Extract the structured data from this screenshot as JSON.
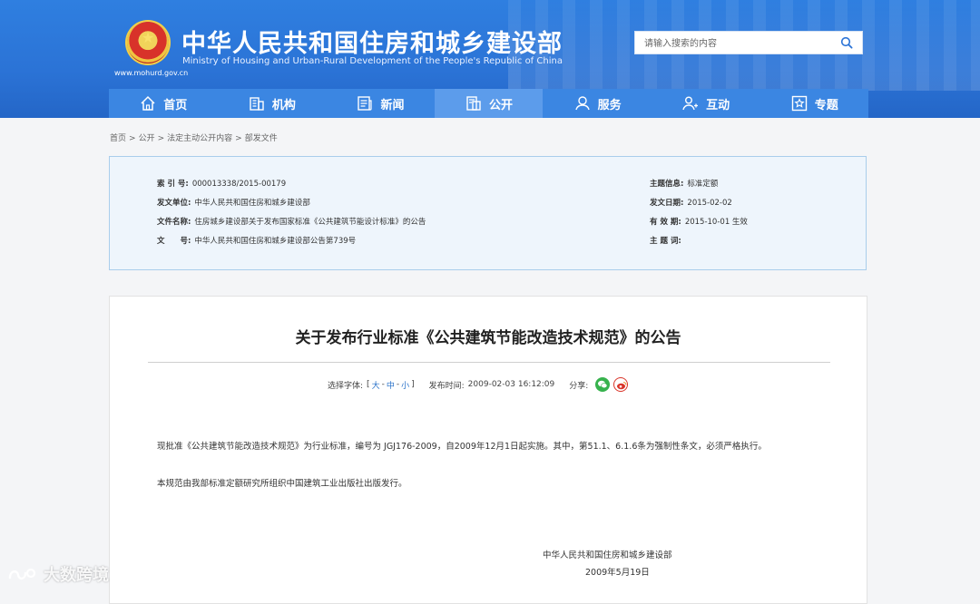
{
  "header": {
    "title": "中华人民共和国住房和城乡建设部",
    "subtitle": "Ministry of Housing and Urban-Rural Development of the People's Republic of China",
    "url": "www.mohurd.gov.cn",
    "emblem_icon": "national-emblem-icon",
    "search": {
      "placeholder": "请输入搜索的内容",
      "icon": "search-icon"
    }
  },
  "nav": {
    "items": [
      {
        "label": "首页",
        "icon": "home-icon",
        "active": false
      },
      {
        "label": "机构",
        "icon": "building-icon",
        "active": false
      },
      {
        "label": "新闻",
        "icon": "newspaper-icon",
        "active": false
      },
      {
        "label": "公开",
        "icon": "document-icon",
        "active": true
      },
      {
        "label": "服务",
        "icon": "service-icon",
        "active": false
      },
      {
        "label": "互动",
        "icon": "people-icon",
        "active": false
      },
      {
        "label": "专题",
        "icon": "star-icon",
        "active": false
      }
    ]
  },
  "breadcrumb": {
    "items": [
      "首页",
      "公开",
      "法定主动公开内容",
      "部发文件"
    ],
    "separator": ">"
  },
  "info": {
    "index_no": {
      "label": "索 引 号:",
      "value": "000013338/2015-00179"
    },
    "issuer": {
      "label": "发文单位:",
      "value": "中华人民共和国住房和城乡建设部"
    },
    "file_name": {
      "label": "文件名称:",
      "value": "住房城乡建设部关于发布国家标准《公共建筑节能设计标准》的公告"
    },
    "doc_no": {
      "label": "文　　号:",
      "value": "中华人民共和国住房和城乡建设部公告第739号"
    },
    "topic": {
      "label": "主题信息:",
      "value": "标准定额"
    },
    "date": {
      "label": "发文日期:",
      "value": "2015-02-02"
    },
    "validity": {
      "label": "有 效 期:",
      "value": "2015-10-01 生效"
    },
    "subject_words": {
      "label": "主 题 词:",
      "value": ""
    }
  },
  "article": {
    "title": "关于发布行业标准《公共建筑节能改造技术规范》的公告",
    "meta": {
      "font_label": "选择字体:",
      "font_open": "[",
      "font_large": "大",
      "font_medium": "中",
      "font_small": "小",
      "font_dash": "-",
      "font_close": "]",
      "publish_label": "发布时间:",
      "publish_time": "2009-02-03 16:12:09",
      "share_label": "分享:"
    },
    "paragraphs": [
      "现批准《公共建筑节能改造技术规范》为行业标准，编号为 JGJ176-2009，自2009年12月1日起实施。其中，第51.1、6.1.6条为强制性条文，必须严格执行。",
      "本规范由我部标准定额研究所组织中国建筑工业出版社出版发行。"
    ],
    "signature": "中华人民共和国住房和城乡建设部",
    "sign_date": "2009年5月19日"
  },
  "watermark": {
    "text": "大数跨境"
  },
  "colors": {
    "header_blue": "#2f7fe0",
    "nav_blue": "#3b86e2",
    "nav_active": "#5c9ceb",
    "info_bg": "#eef5fc",
    "info_border": "#a9cdeb",
    "link_blue": "#2a72c9"
  }
}
